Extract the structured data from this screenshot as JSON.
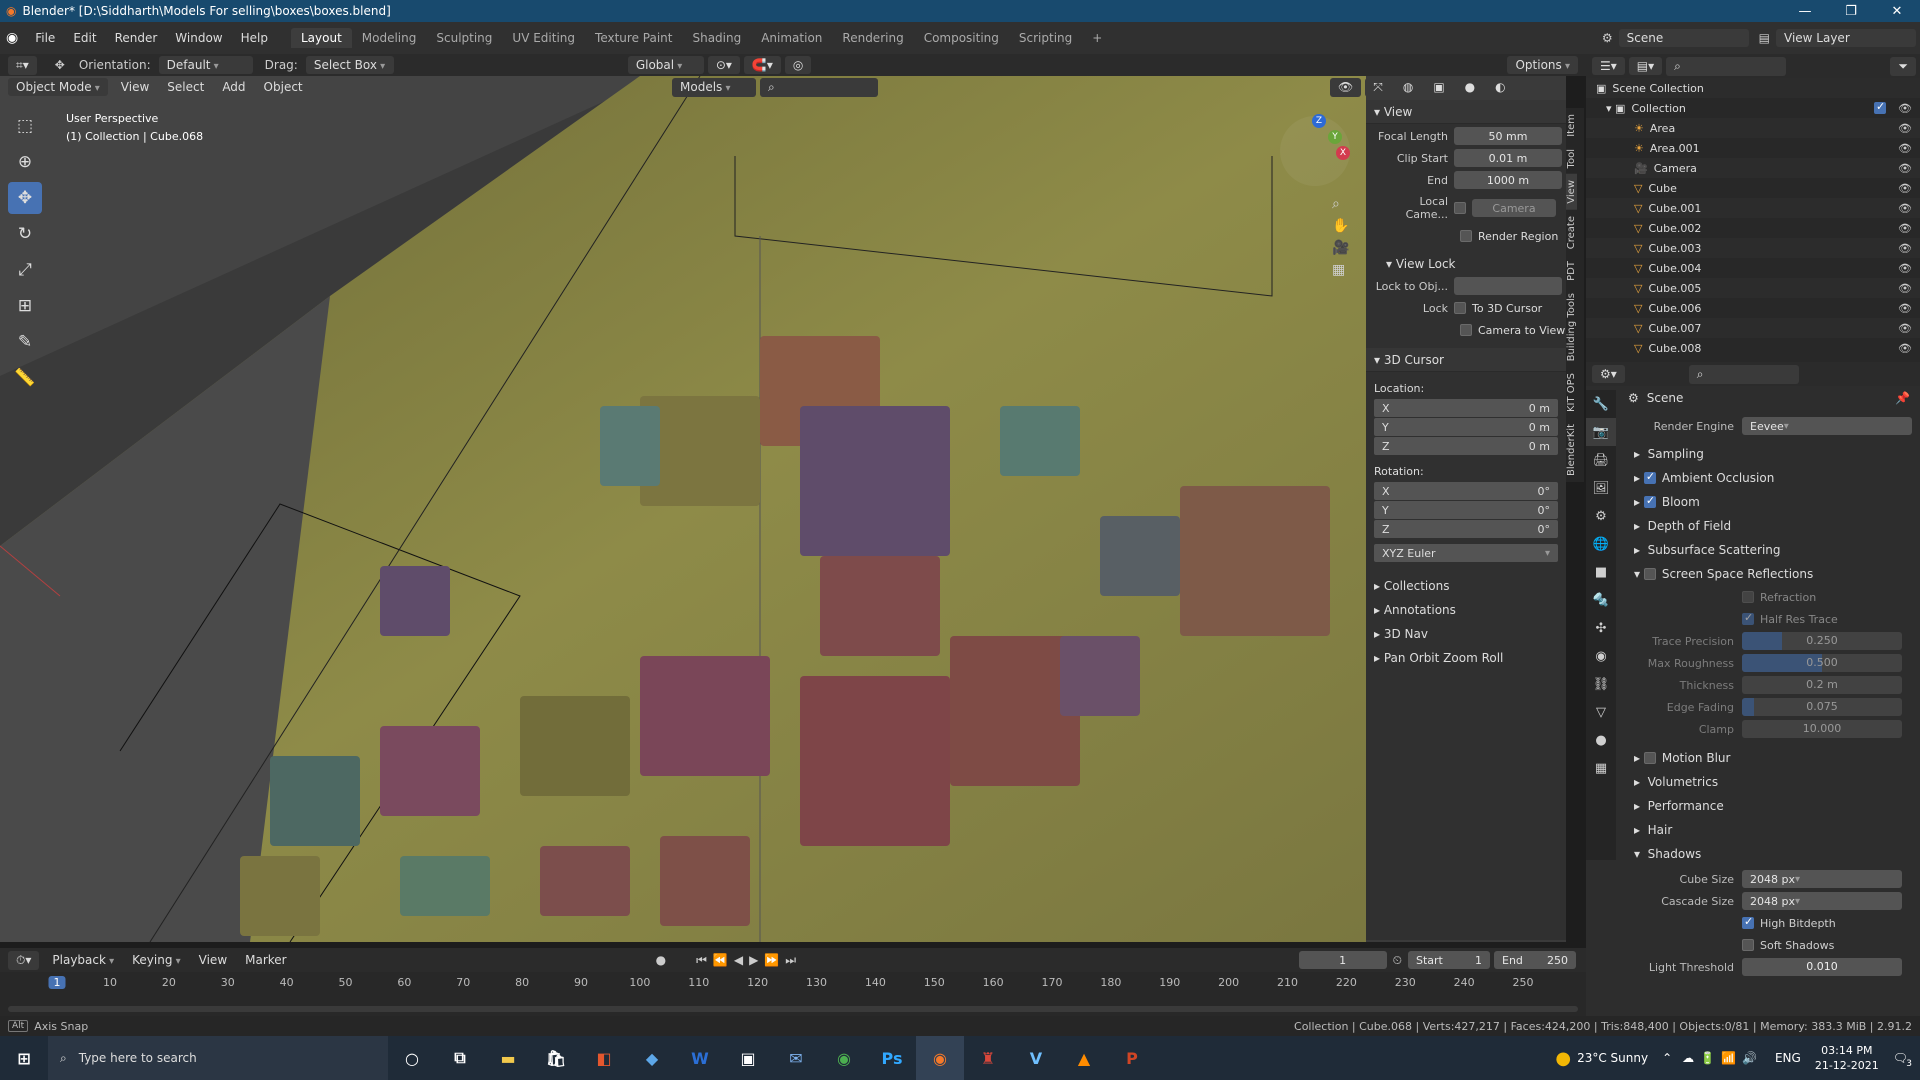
{
  "window": {
    "title": "Blender* [D:\\Siddharth\\Models For selling\\boxes\\boxes.blend]"
  },
  "menubar": {
    "items": [
      "File",
      "Edit",
      "Render",
      "Window",
      "Help"
    ],
    "workspaces": [
      "Layout",
      "Modeling",
      "Sculpting",
      "UV Editing",
      "Texture Paint",
      "Shading",
      "Animation",
      "Rendering",
      "Compositing",
      "Scripting"
    ],
    "scene_label": "Scene",
    "view_layer_label": "View Layer"
  },
  "tool_header": {
    "orientation_label": "Orientation:",
    "orientation_value": "Default",
    "drag_label": "Drag:",
    "drag_value": "Select Box",
    "transform_orientation": "Global",
    "options_label": "Options"
  },
  "viewport_header": {
    "mode": "Object Mode",
    "menus": [
      "View",
      "Select",
      "Add",
      "Object"
    ],
    "collection_filter": "Models"
  },
  "viewport_overlay": {
    "perspective": "User Perspective",
    "context": "(1) Collection | Cube.068"
  },
  "gizmo": {
    "x": "X",
    "y": "Y",
    "z": "Z"
  },
  "npanel": {
    "view_header": "View",
    "focal_length_label": "Focal Length",
    "focal_length": "50 mm",
    "clip_start_label": "Clip Start",
    "clip_start": "0.01 m",
    "clip_end_label": "End",
    "clip_end": "1000 m",
    "local_camera_label": "Local Came...",
    "local_camera_value": "Camera",
    "render_region": "Render Region",
    "view_lock_header": "View Lock",
    "lock_to_obj_label": "Lock to Obj...",
    "lock_label": "Lock",
    "to_3d_cursor": "To 3D Cursor",
    "camera_to_view": "Camera to View",
    "cursor_header": "3D Cursor",
    "location_label": "Location:",
    "loc": [
      {
        "axis": "X",
        "value": "0 m"
      },
      {
        "axis": "Y",
        "value": "0 m"
      },
      {
        "axis": "Z",
        "value": "0 m"
      }
    ],
    "rotation_label": "Rotation:",
    "rot": [
      {
        "axis": "X",
        "value": "0°"
      },
      {
        "axis": "Y",
        "value": "0°"
      },
      {
        "axis": "Z",
        "value": "0°"
      }
    ],
    "rotation_mode": "XYZ Euler",
    "collapsed": [
      "Collections",
      "Annotations",
      "3D Nav",
      "Pan Orbit Zoom Roll"
    ]
  },
  "side_tabs": [
    "Item",
    "Tool",
    "View",
    "Create",
    "PDT",
    "Building Tools",
    "KIT OPS",
    "BlenderKit"
  ],
  "outliner": {
    "root": "Scene Collection",
    "collection": "Collection",
    "items": [
      "Area",
      "Area.001",
      "Camera",
      "Cube",
      "Cube.001",
      "Cube.002",
      "Cube.003",
      "Cube.004",
      "Cube.005",
      "Cube.006",
      "Cube.007",
      "Cube.008"
    ]
  },
  "properties": {
    "context": "Scene",
    "render_engine_label": "Render Engine",
    "render_engine": "Eevee",
    "sections": [
      {
        "label": "Sampling",
        "checkbox": null
      },
      {
        "label": "Ambient Occlusion",
        "checkbox": true
      },
      {
        "label": "Bloom",
        "checkbox": true
      },
      {
        "label": "Depth of Field",
        "checkbox": null
      },
      {
        "label": "Subsurface Scattering",
        "checkbox": null
      }
    ],
    "ssr": {
      "label": "Screen Space Reflections",
      "refraction": "Refraction",
      "half_res": "Half Res Trace",
      "trace_precision_label": "Trace Precision",
      "trace_precision": "0.250",
      "trace_precision_fill": 0.25,
      "max_roughness_label": "Max Roughness",
      "max_roughness": "0.500",
      "max_roughness_fill": 0.5,
      "thickness_label": "Thickness",
      "thickness": "0.2 m",
      "edge_fading_label": "Edge Fading",
      "edge_fading": "0.075",
      "edge_fading_fill": 0.075,
      "clamp_label": "Clamp",
      "clamp": "10.000"
    },
    "sections2": [
      {
        "label": "Motion Blur",
        "checkbox": false
      },
      {
        "label": "Volumetrics",
        "checkbox": null
      },
      {
        "label": "Performance",
        "checkbox": null
      },
      {
        "label": "Hair",
        "checkbox": null
      }
    ],
    "shadows": {
      "label": "Shadows",
      "cube_size_label": "Cube Size",
      "cube_size": "2048 px",
      "cascade_size_label": "Cascade Size",
      "cascade_size": "2048 px",
      "high_bitdepth": "High Bitdepth",
      "soft_shadows": "Soft Shadows",
      "light_threshold_label": "Light Threshold",
      "light_threshold": "0.010"
    }
  },
  "timeline": {
    "menus": [
      "Playback",
      "Keying",
      "View",
      "Marker"
    ],
    "current_frame": "1",
    "start_label": "Start",
    "start": "1",
    "end_label": "End",
    "end": "250",
    "ticks": [
      "1",
      "10",
      "20",
      "30",
      "40",
      "50",
      "60",
      "70",
      "80",
      "90",
      "100",
      "110",
      "120",
      "130",
      "140",
      "150",
      "160",
      "170",
      "180",
      "190",
      "200",
      "210",
      "220",
      "230",
      "240",
      "250"
    ]
  },
  "statusbar": {
    "left": "Axis Snap",
    "right": "Collection | Cube.068 | Verts:427,217 | Faces:424,200 | Tris:848,400 | Objects:0/81 | Memory: 383.3 MiB | 2.91.2"
  },
  "taskbar": {
    "search_placeholder": "Type here to search",
    "weather": "23°C  Sunny",
    "lang": "ENG",
    "time": "03:14 PM",
    "date": "21-12-2021",
    "notification_count": "3"
  },
  "colors": {
    "accent": "#4772b3",
    "titlebar": "#184a6e",
    "floor": "#8d8a47"
  }
}
